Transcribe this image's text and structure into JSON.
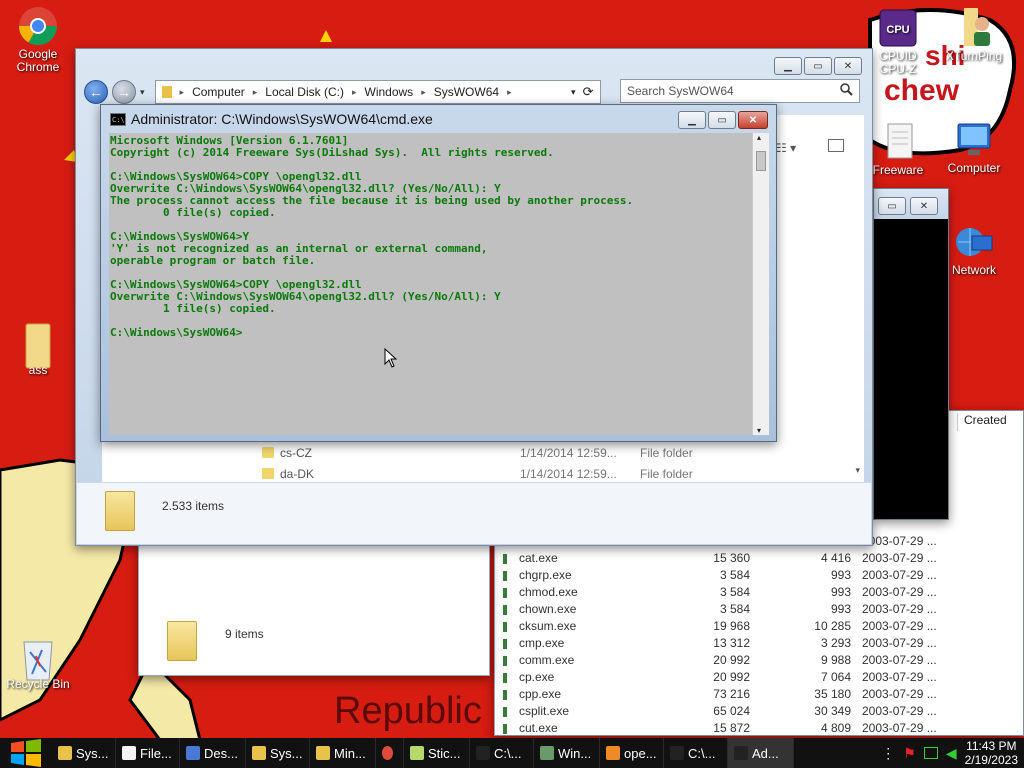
{
  "wallpaper": {
    "text_shi": "shi",
    "text_chew": "chew",
    "text_republic": "Republic"
  },
  "desktop_icons": [
    {
      "label": "Google Chrome",
      "icon": "chrome-icon"
    },
    {
      "label": "ass",
      "icon": "folder-icon"
    },
    {
      "label": "Recycle Bin",
      "icon": "recycle-bin-icon"
    },
    {
      "label": "CPUID CPU-Z",
      "icon": "cpuz-icon"
    },
    {
      "label": "XTurnPing",
      "icon": "person-icon"
    },
    {
      "label": "Freeware",
      "icon": "document-icon"
    },
    {
      "label": "Computer",
      "icon": "computer-icon"
    },
    {
      "label": "Network",
      "icon": "network-icon"
    }
  ],
  "explorer": {
    "breadcrumb": [
      "Computer",
      "Local Disk (C:)",
      "Windows",
      "SysWOW64"
    ],
    "search_placeholder": "Search SysWOW64",
    "rows": [
      {
        "name": "cs-CZ",
        "date": "1/14/2014 12:59...",
        "type": "File folder"
      },
      {
        "name": "da-DK",
        "date": "1/14/2014 12:59...",
        "type": "File folder"
      }
    ],
    "item_count": "2.533 items"
  },
  "explorer2": {
    "item_count": "9 items"
  },
  "explorer3": {
    "header_created": "Created",
    "rows": [
      {
        "name": "",
        "size1": "",
        "size2": "",
        "date": "2003-07-29 ..."
      },
      {
        "name": "cat.exe",
        "size1": "15 360",
        "size2": "4 416",
        "date": "2003-07-29 ..."
      },
      {
        "name": "chgrp.exe",
        "size1": "3 584",
        "size2": "993",
        "date": "2003-07-29 ..."
      },
      {
        "name": "chmod.exe",
        "size1": "3 584",
        "size2": "993",
        "date": "2003-07-29 ..."
      },
      {
        "name": "chown.exe",
        "size1": "3 584",
        "size2": "993",
        "date": "2003-07-29 ..."
      },
      {
        "name": "cksum.exe",
        "size1": "19 968",
        "size2": "10 285",
        "date": "2003-07-29 ..."
      },
      {
        "name": "cmp.exe",
        "size1": "13 312",
        "size2": "3 293",
        "date": "2003-07-29 ..."
      },
      {
        "name": "comm.exe",
        "size1": "20 992",
        "size2": "9 988",
        "date": "2003-07-29 ..."
      },
      {
        "name": "cp.exe",
        "size1": "20 992",
        "size2": "7 064",
        "date": "2003-07-29 ..."
      },
      {
        "name": "cpp.exe",
        "size1": "73 216",
        "size2": "35 180",
        "date": "2003-07-29 ..."
      },
      {
        "name": "csplit.exe",
        "size1": "65 024",
        "size2": "30 349",
        "date": "2003-07-29 ..."
      },
      {
        "name": "cut.exe",
        "size1": "15 872",
        "size2": "4 809",
        "date": "2003-07-29 ..."
      }
    ]
  },
  "cmd": {
    "title": "Administrator: C:\\Windows\\SysWOW64\\cmd.exe",
    "icon_text": "C:\\",
    "lines": [
      "Microsoft Windows [Version 6.1.7601]",
      "Copyright (c) 2014 Freeware Sys(DiLshad Sys).  All rights reserved.",
      "",
      "C:\\Windows\\SysWOW64>COPY \\opengl32.dll",
      "Overwrite C:\\Windows\\SysWOW64\\opengl32.dll? (Yes/No/All): Y",
      "The process cannot access the file because it is being used by another process.",
      "        0 file(s) copied.",
      "",
      "C:\\Windows\\SysWOW64>Y",
      "'Y' is not recognized as an internal or external command,",
      "operable program or batch file.",
      "",
      "C:\\Windows\\SysWOW64>COPY \\opengl32.dll",
      "Overwrite C:\\Windows\\SysWOW64\\opengl32.dll? (Yes/No/All): Y",
      "        1 file(s) copied.",
      "",
      "C:\\Windows\\SysWOW64>"
    ]
  },
  "taskbar": {
    "items": [
      {
        "label": "Sys...",
        "icon": "folder-icon",
        "color": "#e8c24a"
      },
      {
        "label": "File...",
        "icon": "file-icon",
        "color": "#f4f4f4"
      },
      {
        "label": "Des...",
        "icon": "desktop-icon",
        "color": "#4a78d6"
      },
      {
        "label": "Sys...",
        "icon": "folder-icon",
        "color": "#e8c24a"
      },
      {
        "label": "Min...",
        "icon": "folder-icon",
        "color": "#e8c24a"
      },
      {
        "label": "",
        "icon": "chrome-icon",
        "color": "#dd4b39"
      },
      {
        "label": "Stic...",
        "icon": "sticky-icon",
        "color": "#b6d96b"
      },
      {
        "label": "C:\\...",
        "icon": "console-icon",
        "color": "#222222"
      },
      {
        "label": "Win...",
        "icon": "monitor-icon",
        "color": "#6a9a6a"
      },
      {
        "label": "ope...",
        "icon": "search-icon",
        "color": "#f08a24"
      },
      {
        "label": "C:\\...",
        "icon": "console-icon",
        "color": "#222222"
      },
      {
        "label": "Ad...",
        "icon": "console-icon",
        "color": "#222222"
      }
    ],
    "time": "11:43 PM",
    "date": "2/19/2023"
  }
}
